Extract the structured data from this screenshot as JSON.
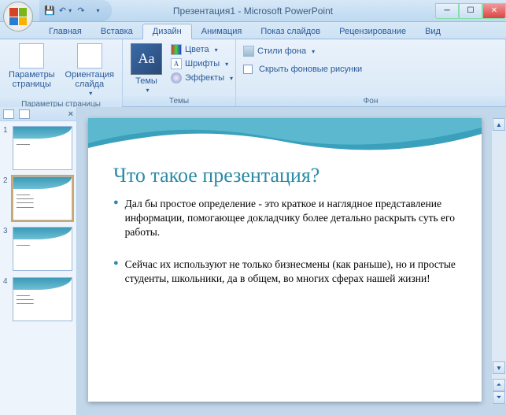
{
  "title": "Презентация1 - Microsoft PowerPoint",
  "qat": {
    "save": "💾",
    "undo": "↶",
    "redo": "↷"
  },
  "tabs": [
    {
      "label": "Главная"
    },
    {
      "label": "Вставка"
    },
    {
      "label": "Дизайн"
    },
    {
      "label": "Анимация"
    },
    {
      "label": "Показ слайдов"
    },
    {
      "label": "Рецензирование"
    },
    {
      "label": "Вид"
    }
  ],
  "ribbon": {
    "page_params": "Параметры страницы",
    "orientation": "Ориентация слайда",
    "group_page": "Параметры страницы",
    "themes": "Темы",
    "themes_glyph": "Aa",
    "colors": "Цвета",
    "fonts": "Шрифты",
    "effects": "Эффекты",
    "group_themes": "Темы",
    "bg_styles": "Стили фона",
    "hide_bg": "Скрыть фоновые рисунки",
    "group_bg": "Фон"
  },
  "thumbs": {
    "items": [
      {
        "num": "1"
      },
      {
        "num": "2"
      },
      {
        "num": "3"
      },
      {
        "num": "4"
      }
    ]
  },
  "slide": {
    "title": "Что такое презентация?",
    "bullets": [
      "Дал бы простое определение - это краткое и наглядное представление информации, помогающее докладчику более детально раскрыть суть его работы.",
      "Сейчас их используют не только бизнесмены (как раньше), но и простые студенты, школьники, да в общем, во многих сферах нашей жизни!"
    ]
  }
}
